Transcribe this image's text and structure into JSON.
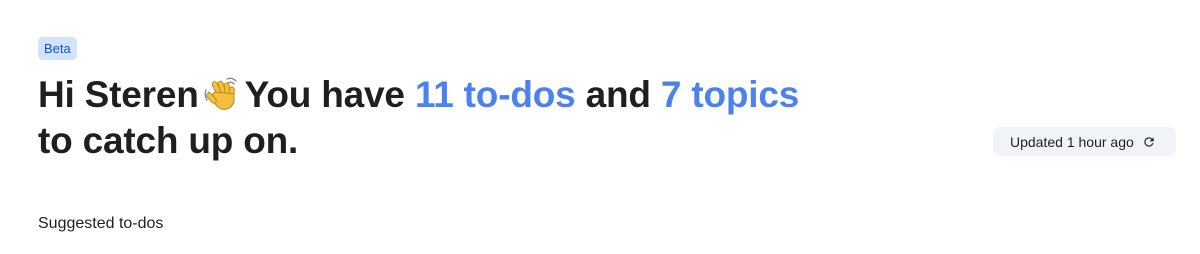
{
  "badge": {
    "label": "Beta"
  },
  "greeting": {
    "hello": "Hi Steren",
    "wave_icon": "waving-hand-icon",
    "you_have": "You have",
    "todos_link": "11 to-dos",
    "and": "and",
    "topics_link": "7 topics",
    "tail": "to catch up on."
  },
  "status": {
    "updated_label": "Updated 1 hour ago",
    "refresh_icon": "refresh-icon"
  },
  "sections": {
    "suggested_todos_title": "Suggested to-dos"
  },
  "colors": {
    "accent": "#4c82ee",
    "badge_bg": "#d3e3fd",
    "badge_text": "#0b57d0",
    "chip_bg": "#f0f4f9",
    "text": "#1f1f1f"
  }
}
